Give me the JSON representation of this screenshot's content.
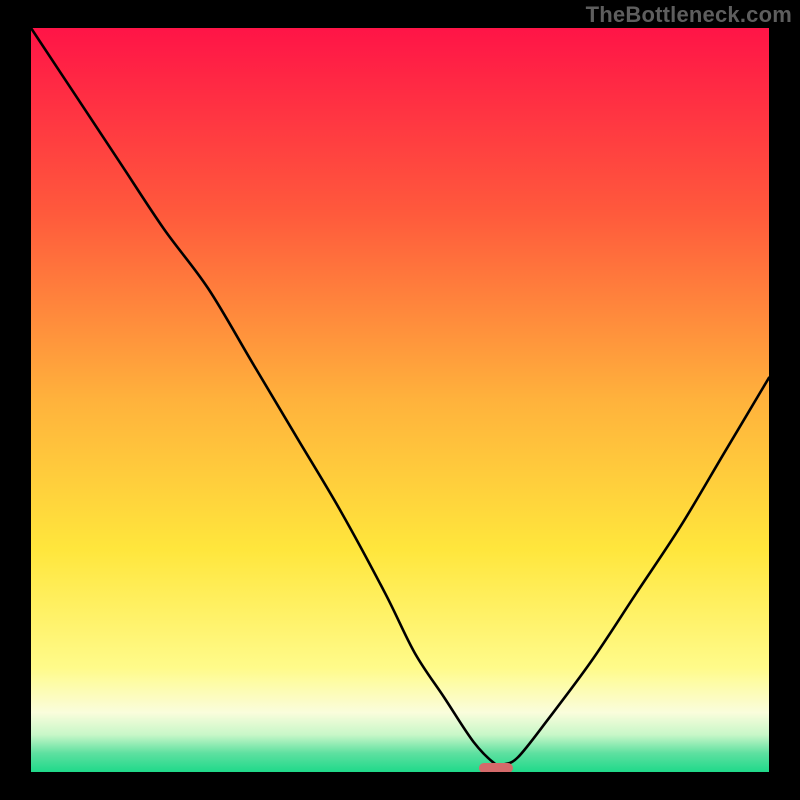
{
  "watermark": "TheBottleneck.com",
  "chart_data": {
    "type": "line",
    "title": "",
    "xlabel": "",
    "ylabel": "",
    "xlim": [
      0,
      100
    ],
    "ylim": [
      0,
      100
    ],
    "series": [
      {
        "name": "curve",
        "x": [
          0,
          6,
          12,
          18,
          24,
          30,
          36,
          42,
          48,
          52,
          56,
          60,
          63,
          64,
          66,
          70,
          76,
          82,
          88,
          94,
          100
        ],
        "values": [
          100,
          91,
          82,
          73,
          65,
          55,
          45,
          35,
          24,
          16,
          10,
          4,
          1,
          1,
          2,
          7,
          15,
          24,
          33,
          43,
          53
        ]
      }
    ],
    "marker": {
      "x": 63,
      "y": 0,
      "color": "#d46a6a"
    }
  },
  "gradient": {
    "stops": [
      {
        "offset": 0.0,
        "color": "#ff1447"
      },
      {
        "offset": 0.25,
        "color": "#ff5a3c"
      },
      {
        "offset": 0.5,
        "color": "#ffb23c"
      },
      {
        "offset": 0.7,
        "color": "#ffe63c"
      },
      {
        "offset": 0.86,
        "color": "#fffb8a"
      },
      {
        "offset": 0.92,
        "color": "#fafddc"
      },
      {
        "offset": 0.95,
        "color": "#c8f7c8"
      },
      {
        "offset": 0.975,
        "color": "#5de0a0"
      },
      {
        "offset": 1.0,
        "color": "#1fd98a"
      }
    ]
  }
}
